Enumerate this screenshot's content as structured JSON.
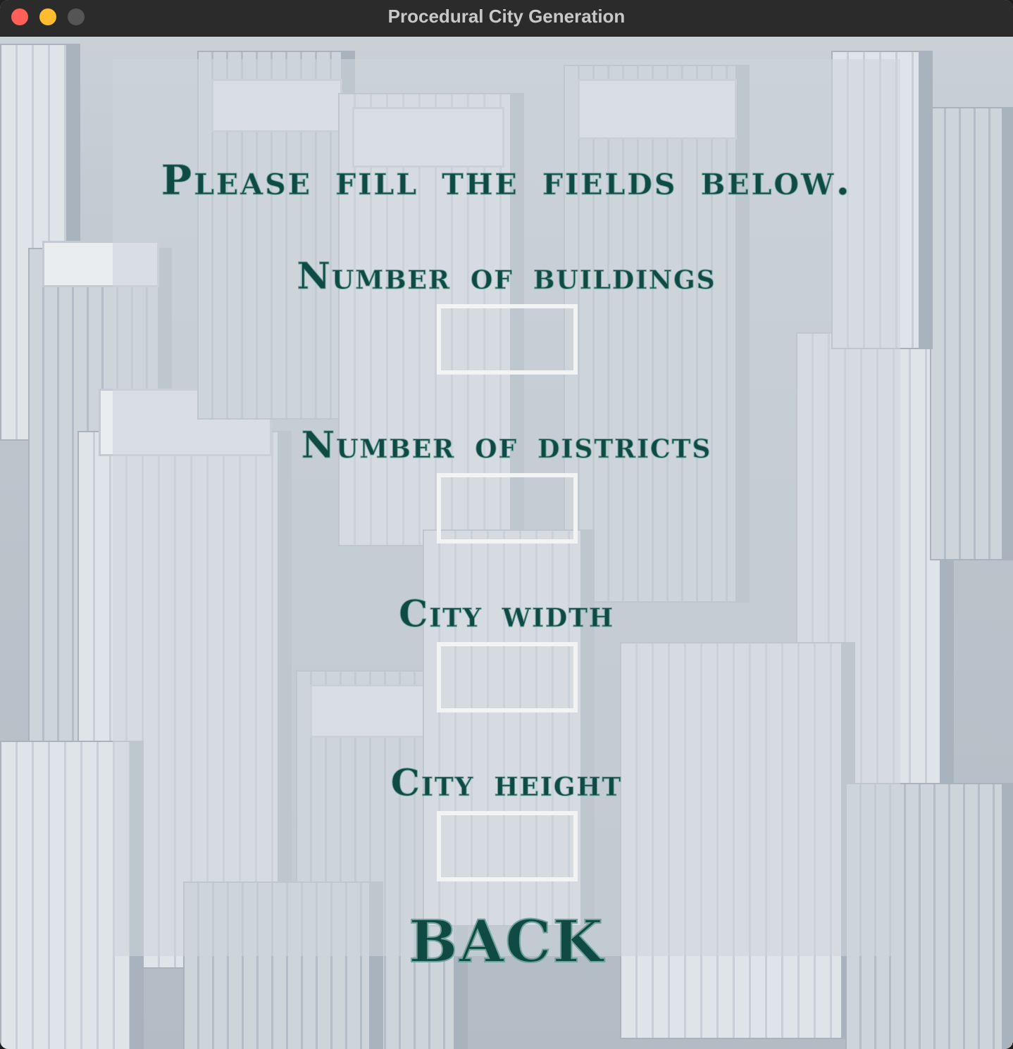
{
  "window": {
    "title": "Procedural City Generation"
  },
  "form": {
    "heading": "Please fill the fields below.",
    "fields": [
      {
        "label": "Number of buildings",
        "value": ""
      },
      {
        "label": "Number of districts",
        "value": ""
      },
      {
        "label": "City width",
        "value": ""
      },
      {
        "label": "City height",
        "value": ""
      }
    ],
    "back_label": "BACK"
  },
  "colors": {
    "text": "#0f4a45",
    "input_border": "#f2f3f4",
    "titlebar": "#2b2b2b",
    "close": "#fe5f57",
    "minimize": "#febc2e",
    "maximize": "#555555"
  }
}
